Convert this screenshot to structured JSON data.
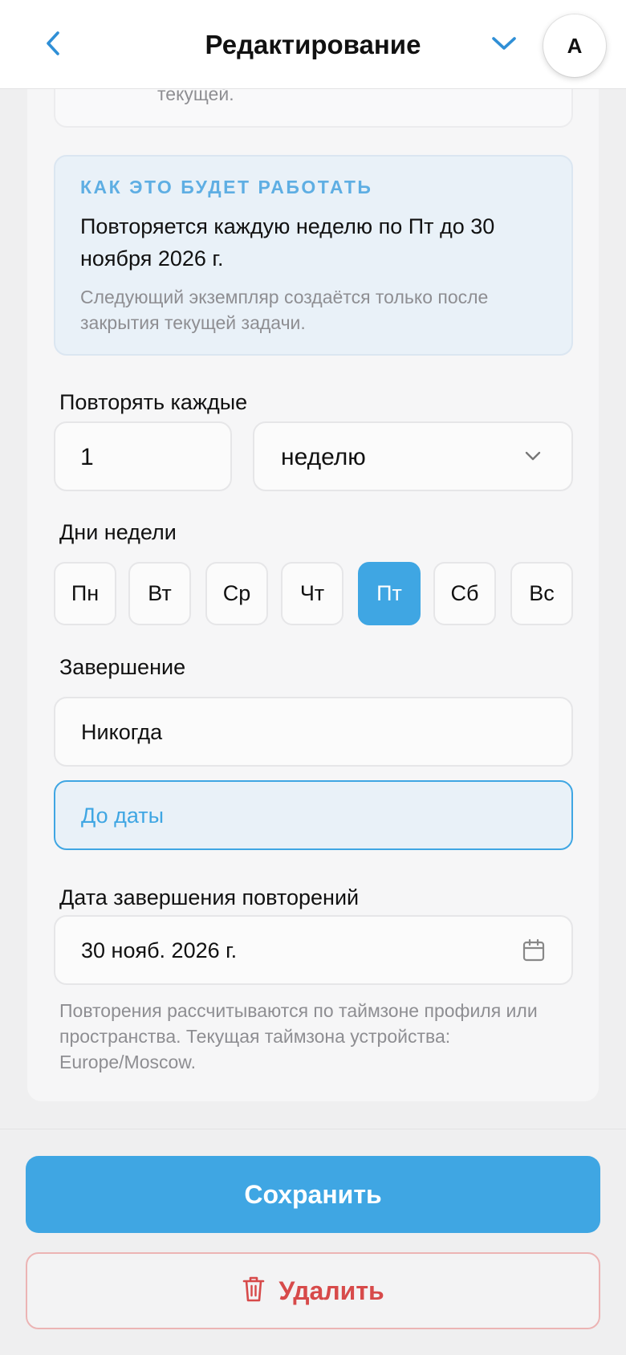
{
  "header": {
    "title": "Редактирование",
    "avatar_letter": "A"
  },
  "previous_note_tail": "текущей.",
  "info": {
    "title": "КАК ЭТО БУДЕТ РАБОТАТЬ",
    "main": "Повторяется каждую неделю по Пт до 30 ноября 2026 г.",
    "sub": "Следующий экземпляр создаётся только после закрытия текущей задачи."
  },
  "repeat": {
    "label": "Повторять каждые",
    "interval_value": "1",
    "unit_selected": "неделю"
  },
  "weekdays": {
    "label": "Дни недели",
    "days": [
      "Пн",
      "Вт",
      "Ср",
      "Чт",
      "Пт",
      "Сб",
      "Вс"
    ],
    "selected": "Пт"
  },
  "ending": {
    "label": "Завершение",
    "options": [
      "Никогда",
      "До даты"
    ],
    "selected": "До даты"
  },
  "end_date": {
    "label": "Дата завершения повторений",
    "value": "30 нояб. 2026 г."
  },
  "hint": "Повторения рассчитываются по таймзоне профиля или пространства. Текущая таймзона устройства: Europe/Moscow.",
  "actions": {
    "save": "Сохранить",
    "delete": "Удалить"
  },
  "colors": {
    "accent": "#3fa6e3",
    "danger": "#d74a4a"
  }
}
